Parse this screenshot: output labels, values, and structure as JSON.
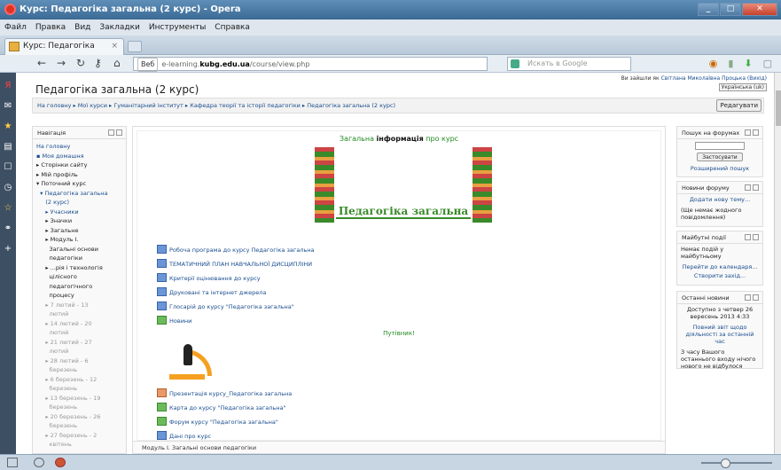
{
  "window": {
    "title": "Курс: Педагогіка загальна (2 курс) - Opera",
    "min": "_",
    "max": "□",
    "close": "✕"
  },
  "menu": [
    "Файл",
    "Правка",
    "Вид",
    "Закладки",
    "Инструменты",
    "Справка"
  ],
  "tab": {
    "label": "Курс: Педагогіка загал...",
    "close": "×"
  },
  "address": {
    "badge": "Веб",
    "prefix": "e-learning.",
    "host": "kubg.edu.ua",
    "path": "/course/view.php",
    "search_placeholder": "Искать в Google"
  },
  "page": {
    "course_title": "Педагогіка загальна (2 курс)",
    "login_prefix": "Ви зайшли як",
    "login_user": "Світлана Миколаївна Процька",
    "login_exit": "(Вихід)",
    "language": "Українська (uk)",
    "breadcrumb": "На головну ▸ Мої курси ▸ Гуманітарний інститут ▸ Кафедра теорії та історії педагогіки ▸ Педагогіка загальна (2 курс)",
    "edit_button": "Редагувати"
  },
  "navigation": {
    "title": "Навігація",
    "items": [
      {
        "label": "На головну",
        "cls": ""
      },
      {
        "label": "▪ Моя домашня",
        "cls": ""
      },
      {
        "label": "▸ Сторінки сайту",
        "cls": "k"
      },
      {
        "label": "▸ Мій профіль",
        "cls": "k"
      },
      {
        "label": "▾ Поточний курс",
        "cls": "k"
      },
      {
        "label": "  ▾ Педагогіка загальна",
        "cls": ""
      },
      {
        "label": "     (2 курс)",
        "cls": ""
      },
      {
        "label": "     ▸ Учасники",
        "cls": ""
      },
      {
        "label": "     ▸ Значки",
        "cls": "k"
      },
      {
        "label": "     ▸ Загальне",
        "cls": "k"
      },
      {
        "label": "     ▸ Модуль І.",
        "cls": "k"
      },
      {
        "label": "       Загальні основи",
        "cls": "k"
      },
      {
        "label": "       педагогіки",
        "cls": "k"
      },
      {
        "label": "     ▸ ...рія і технологія",
        "cls": "k"
      },
      {
        "label": "       цілісного",
        "cls": "k"
      },
      {
        "label": "       педагогічного",
        "cls": "k"
      },
      {
        "label": "       процесу",
        "cls": "k"
      },
      {
        "label": "     ▸ 7 лютий - 13",
        "cls": "g"
      },
      {
        "label": "       лютий",
        "cls": "g"
      },
      {
        "label": "     ▸ 14 лютий - 20",
        "cls": "g"
      },
      {
        "label": "       лютий",
        "cls": "g"
      },
      {
        "label": "     ▸ 21 лютий - 27",
        "cls": "g"
      },
      {
        "label": "       лютий",
        "cls": "g"
      },
      {
        "label": "     ▸ 28 лютий - 6",
        "cls": "g"
      },
      {
        "label": "       березень",
        "cls": "g"
      },
      {
        "label": "     ▸ 6 березень - 12",
        "cls": "g"
      },
      {
        "label": "       березень",
        "cls": "g"
      },
      {
        "label": "     ▸ 13 березень - 19",
        "cls": "g"
      },
      {
        "label": "       березень",
        "cls": "g"
      },
      {
        "label": "     ▸ 20 березень - 26",
        "cls": "g"
      },
      {
        "label": "       березень",
        "cls": "g"
      },
      {
        "label": "     ▸ 27 березень - 2",
        "cls": "g"
      },
      {
        "label": "       квітень",
        "cls": "g"
      }
    ]
  },
  "main": {
    "info_pre": "Загальна ",
    "info_bold": "інформація",
    "info_post": " про курс",
    "banner": "Педагогіка загальна",
    "resources": [
      "Робоча програма до курсу Педагогіка загальна",
      "ТЕМАТИЧНИЙ ПЛАН НАВЧАЛЬНОЇ ДИСЦИПЛІНИ",
      "Критерії оцінювання до курсу",
      "Друковані та інтернет джерела",
      "Глосарій до курсу \"Педагогіка загальна\"",
      "Новини"
    ],
    "guide": "Путівник!",
    "guide_items": [
      "Презентація курсу_Педагогіка загальна",
      "Карта до курсу \"Педагогіка загальна\"",
      "Форум курсу \"Педагогіка загальна\"",
      "Дані про курс"
    ],
    "next_section": "Модуль І. Загальні основи педагогіки"
  },
  "right": {
    "forum_search": {
      "title": "Пошук на форумах",
      "button": "Застосувати",
      "advanced": "Розширений пошук"
    },
    "news": {
      "title": "Новини форуму",
      "add": "Додати нову тему...",
      "empty": "(Ще немає жодного повідомлення)"
    },
    "events": {
      "title": "Майбутні події",
      "empty": "Немає подій у майбутньому",
      "calendar": "Перейти до календаря...",
      "create": "Створити захід..."
    },
    "recent": {
      "title": "Останні новини",
      "line1": "Доступно з четвер 26",
      "line2": "вересень 2013 4:33",
      "link": "Повний звіт щодо діяльності за останній час",
      "note": "З часу Вашого останнього входу нічого нового не відбулося"
    }
  }
}
